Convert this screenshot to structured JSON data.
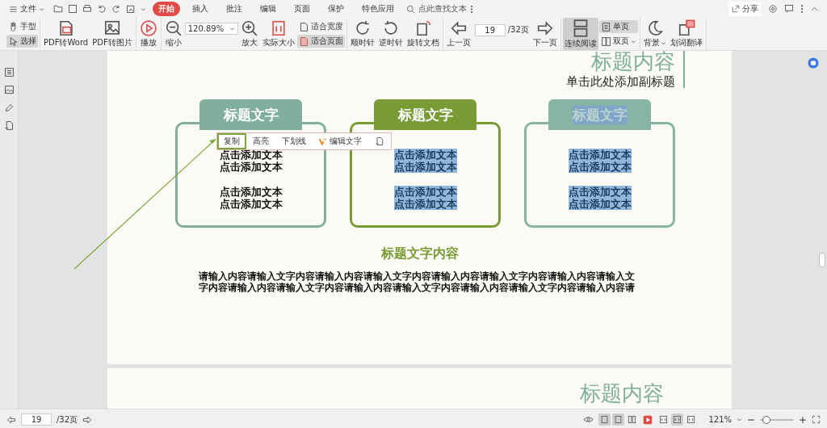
{
  "menu_bar": {
    "file": "文件",
    "tabs": [
      {
        "label": "开始",
        "selected": true
      },
      {
        "label": "插入",
        "selected": false
      },
      {
        "label": "批注",
        "selected": false
      },
      {
        "label": "编辑",
        "selected": false
      },
      {
        "label": "页面",
        "selected": false
      },
      {
        "label": "保护",
        "selected": false
      },
      {
        "label": "特色应用",
        "selected": false
      }
    ],
    "search": {
      "placeholder": "点此查找文本"
    },
    "share": "分享"
  },
  "toolbar": {
    "groups": [
      [
        {
          "kind": "pair",
          "items": [
            {
              "label": "手型",
              "selected": false
            },
            {
              "label": "选择",
              "selected": true
            }
          ]
        }
      ],
      [
        {
          "kind": "big",
          "label": "PDF转Word",
          "selected": false
        },
        {
          "kind": "big",
          "label": "PDF转图片",
          "selected": false
        }
      ],
      [
        {
          "kind": "big",
          "label": "播放",
          "selected": false
        }
      ],
      [
        {
          "kind": "big",
          "label": "缩小",
          "selected": false
        },
        {
          "kind": "zoom",
          "value": "120.89%"
        },
        {
          "kind": "big",
          "label": "放大",
          "selected": false
        },
        {
          "kind": "big",
          "label": "实际大小",
          "selected": false
        },
        {
          "kind": "pair",
          "items": [
            {
              "label": "适合宽度",
              "selected": false
            },
            {
              "label": "适合页面",
              "selected": true
            }
          ]
        }
      ],
      [
        {
          "kind": "big",
          "label": "顺时针",
          "selected": false
        },
        {
          "kind": "big",
          "label": "逆时针",
          "selected": false
        },
        {
          "kind": "big",
          "label": "旋转文档",
          "selected": false
        }
      ],
      [
        {
          "kind": "big",
          "label": "上一页",
          "selected": false
        },
        {
          "kind": "page",
          "value": "19",
          "total": "/32页"
        },
        {
          "kind": "big",
          "label": "下一页",
          "selected": false
        }
      ],
      [
        {
          "kind": "big",
          "label": "连续阅读",
          "selected": true
        },
        {
          "kind": "pair",
          "items": [
            {
              "label": "单页",
              "selected": true
            },
            {
              "label": "双页",
              "selected": false,
              "dropdown": true
            }
          ]
        }
      ],
      [
        {
          "kind": "big",
          "label": "背景",
          "selected": false,
          "dropdown": true
        },
        {
          "kind": "big",
          "label": "划词翻译",
          "selected": false
        }
      ]
    ]
  },
  "document": {
    "title": "标题内容",
    "subtitle": "单击此处添加副标题",
    "cards": [
      {
        "title": "标题文字",
        "color": "#80ae9f",
        "title_selected": false,
        "body_selected": false,
        "paragraphs": [
          [
            "点击添加文本",
            "点击添加文本"
          ],
          [
            "点击添加文本",
            "点击添加文本"
          ]
        ]
      },
      {
        "title": "标题文字",
        "color": "#799b36",
        "title_selected": false,
        "body_selected": true,
        "paragraphs": [
          [
            "点击添加文本",
            "点击添加文本"
          ],
          [
            "点击添加文本",
            "点击添加文本"
          ]
        ]
      },
      {
        "title": "标题文字",
        "color": "#86b5a6",
        "title_selected": true,
        "body_selected": true,
        "paragraphs": [
          [
            "点击添加文本",
            "点击添加文本"
          ],
          [
            "点击添加文本",
            "点击添加文本"
          ]
        ]
      }
    ],
    "heading": "标题文字内容",
    "paragraph": "请输入内容请输入文字内容请输入内容请输入文字内容请输入内容请输入文字内容请输入内容请输入文字内容请输入内容请输入文字内容请输入内容请输入文字内容请输入内容请输入文字内容请输入内容请",
    "next_page_title": "标题内容"
  },
  "context_menu": [
    {
      "kind": "text",
      "label": "复制",
      "selected": true
    },
    {
      "kind": "text",
      "label": "高亮",
      "selected": false
    },
    {
      "kind": "text",
      "label": "下划线",
      "selected": false
    },
    {
      "kind": "icon-text",
      "label": "编辑文字",
      "selected": false
    },
    {
      "kind": "icon",
      "selected": false
    }
  ],
  "status_bar": {
    "page": "19",
    "total": "/32页",
    "views": [
      {
        "selected": true
      },
      {
        "selected": true
      },
      {
        "selected": false
      }
    ],
    "fits": [
      {
        "selected": false
      },
      {
        "selected": true
      },
      {
        "selected": false
      }
    ],
    "zoom": "121%",
    "zoom_slider": {
      "level": 0.2
    }
  }
}
